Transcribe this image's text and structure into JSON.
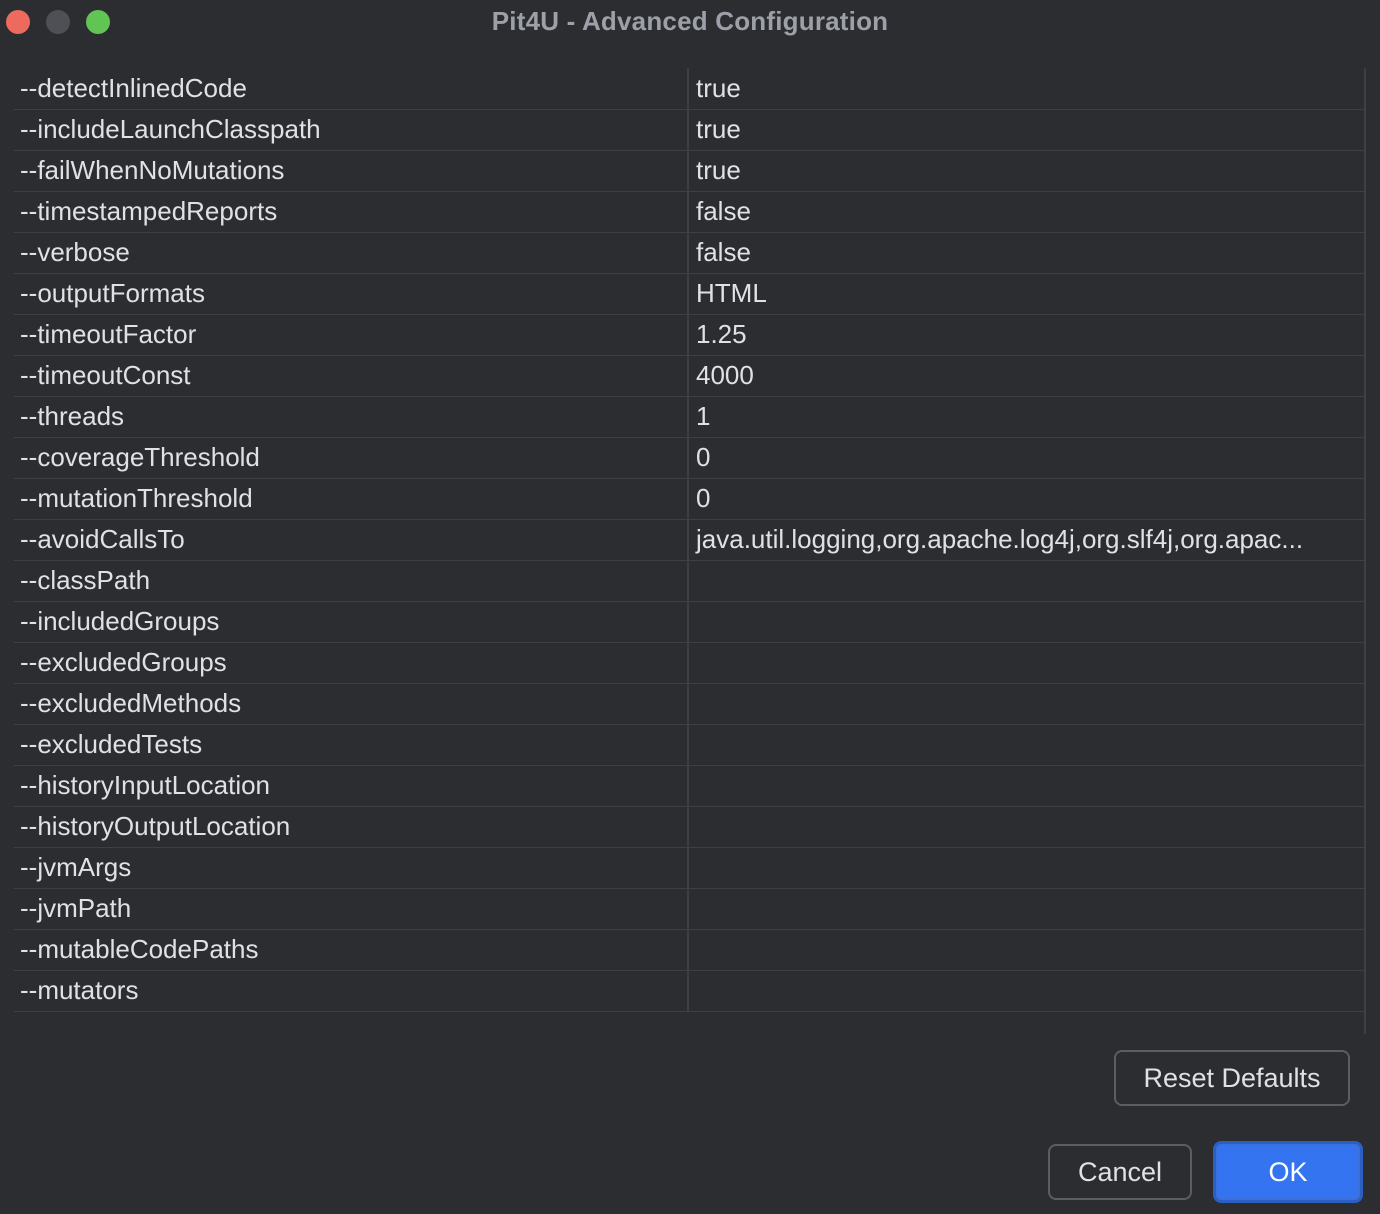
{
  "window": {
    "title": "Pit4U - Advanced Configuration"
  },
  "options": [
    {
      "key": "--detectInlinedCode",
      "value": "true"
    },
    {
      "key": "--includeLaunchClasspath",
      "value": "true"
    },
    {
      "key": "--failWhenNoMutations",
      "value": "true"
    },
    {
      "key": "--timestampedReports",
      "value": "false"
    },
    {
      "key": "--verbose",
      "value": "false"
    },
    {
      "key": "--outputFormats",
      "value": "HTML"
    },
    {
      "key": "--timeoutFactor",
      "value": "1.25"
    },
    {
      "key": "--timeoutConst",
      "value": "4000"
    },
    {
      "key": "--threads",
      "value": "1"
    },
    {
      "key": "--coverageThreshold",
      "value": "0"
    },
    {
      "key": "--mutationThreshold",
      "value": "0"
    },
    {
      "key": "--avoidCallsTo",
      "value": "java.util.logging,org.apache.log4j,org.slf4j,org.apac..."
    },
    {
      "key": "--classPath",
      "value": ""
    },
    {
      "key": "--includedGroups",
      "value": ""
    },
    {
      "key": "--excludedGroups",
      "value": ""
    },
    {
      "key": "--excludedMethods",
      "value": ""
    },
    {
      "key": "--excludedTests",
      "value": ""
    },
    {
      "key": "--historyInputLocation",
      "value": ""
    },
    {
      "key": "--historyOutputLocation",
      "value": ""
    },
    {
      "key": "--jvmArgs",
      "value": ""
    },
    {
      "key": "--jvmPath",
      "value": ""
    },
    {
      "key": "--mutableCodePaths",
      "value": ""
    },
    {
      "key": "--mutators",
      "value": ""
    }
  ],
  "buttons": {
    "reset_defaults": "Reset Defaults",
    "cancel": "Cancel",
    "ok": "OK"
  },
  "colors": {
    "background": "#2b2d30",
    "primary_button": "#3574f0",
    "close": "#ee6a5f",
    "minimize_inactive": "#4e5055",
    "maximize": "#61c554"
  }
}
